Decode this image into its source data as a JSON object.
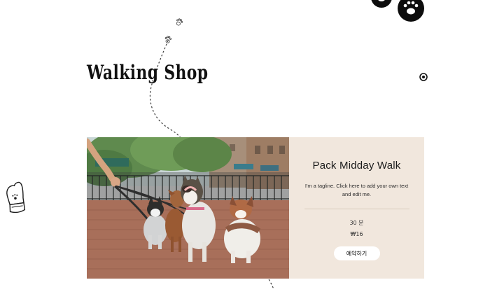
{
  "header": {
    "site_title": "Walking Shop"
  },
  "service": {
    "title": "Pack Midday Walk",
    "tagline": "I'm a tagline. Click here to add your own text and edit me.",
    "duration": "30 분",
    "price": "₩16",
    "book_label": "예약하기"
  },
  "icons": {
    "target": "target-icon",
    "paw_large": "paw-icon",
    "paw_small": "paw-print-icon",
    "mitten": "mitten-icon"
  },
  "colors": {
    "card_background": "#f1e7dd",
    "button_background": "#ffffff",
    "text_dark": "#111111"
  }
}
